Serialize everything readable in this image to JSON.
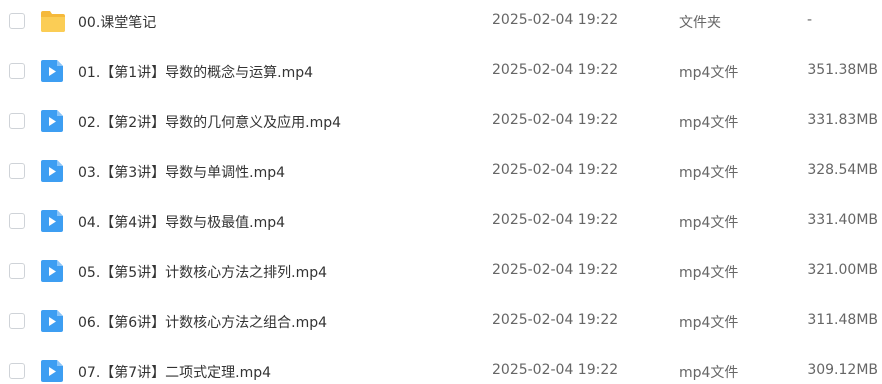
{
  "files": [
    {
      "name": "00.课堂笔记",
      "date": "2025-02-04 19:22",
      "type": "文件夹",
      "size": "-",
      "icon": "folder-icon"
    },
    {
      "name": "01.【第1讲】导数的概念与运算.mp4",
      "date": "2025-02-04 19:22",
      "type": "mp4文件",
      "size": "351.38MB",
      "icon": "video-file-icon"
    },
    {
      "name": "02.【第2讲】导数的几何意义及应用.mp4",
      "date": "2025-02-04 19:22",
      "type": "mp4文件",
      "size": "331.83MB",
      "icon": "video-file-icon"
    },
    {
      "name": "03.【第3讲】导数与单调性.mp4",
      "date": "2025-02-04 19:22",
      "type": "mp4文件",
      "size": "328.54MB",
      "icon": "video-file-icon"
    },
    {
      "name": "04.【第4讲】导数与极最值.mp4",
      "date": "2025-02-04 19:22",
      "type": "mp4文件",
      "size": "331.40MB",
      "icon": "video-file-icon"
    },
    {
      "name": "05.【第5讲】计数核心方法之排列.mp4",
      "date": "2025-02-04 19:22",
      "type": "mp4文件",
      "size": "321.00MB",
      "icon": "video-file-icon"
    },
    {
      "name": "06.【第6讲】计数核心方法之组合.mp4",
      "date": "2025-02-04 19:22",
      "type": "mp4文件",
      "size": "311.48MB",
      "icon": "video-file-icon"
    },
    {
      "name": "07.【第7讲】二项式定理.mp4",
      "date": "2025-02-04 19:22",
      "type": "mp4文件",
      "size": "309.12MB",
      "icon": "video-file-icon"
    }
  ],
  "colors": {
    "folder": "#f7c34a",
    "video": "#3d9ef2"
  }
}
